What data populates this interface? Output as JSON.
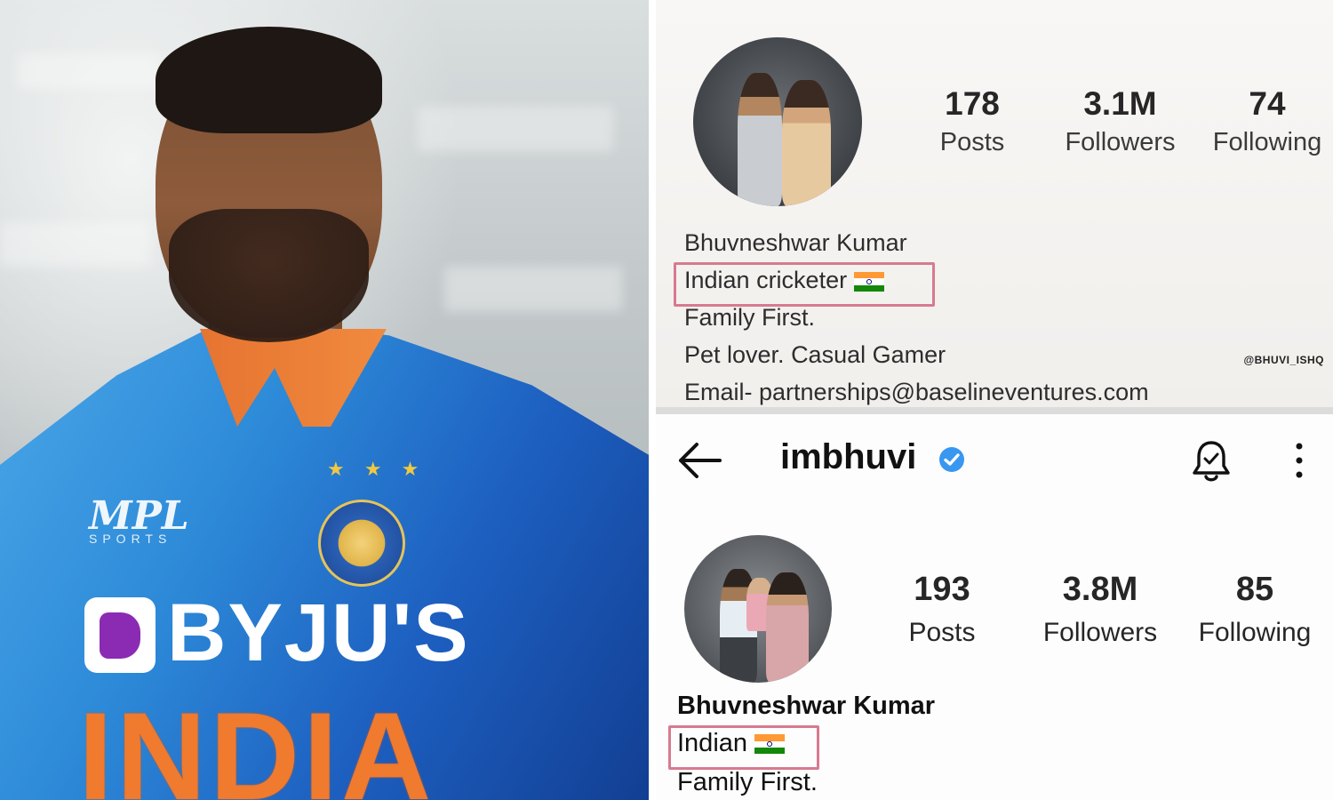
{
  "photo": {
    "jersey_brand": "MPL",
    "jersey_brand_sub": "SPORTS",
    "sponsor": "BYJU'S",
    "team": "INDIA",
    "stars": "★ ★ ★"
  },
  "old_profile": {
    "stats": [
      {
        "value": "178",
        "label": "Posts"
      },
      {
        "value": "3.1M",
        "label": "Followers"
      },
      {
        "value": "74",
        "label": "Following"
      }
    ],
    "name": "Bhuvneshwar Kumar",
    "bio_highlight": "Indian cricketer",
    "bio_lines": [
      "Family First.",
      "Pet lover. Casual Gamer",
      "Email- partnerships@baselineventures.com"
    ],
    "watermark": "@BHUVI_ISHQ"
  },
  "new_profile": {
    "username": "imbhuvi",
    "icons": [
      "back-arrow-icon",
      "verified-badge-icon",
      "notification-bell-icon",
      "more-options-icon"
    ],
    "stats": [
      {
        "value": "193",
        "label": "Posts"
      },
      {
        "value": "3.8M",
        "label": "Followers"
      },
      {
        "value": "85",
        "label": "Following"
      }
    ],
    "name": "Bhuvneshwar Kumar",
    "bio_highlight": "Indian",
    "bio_lines": [
      "Family First."
    ]
  },
  "colors": {
    "highlight_box": "#d77a8f",
    "verified_blue": "#3897f0",
    "jersey_blue": "#2d8ad8",
    "jersey_orange": "#f07a2e"
  }
}
